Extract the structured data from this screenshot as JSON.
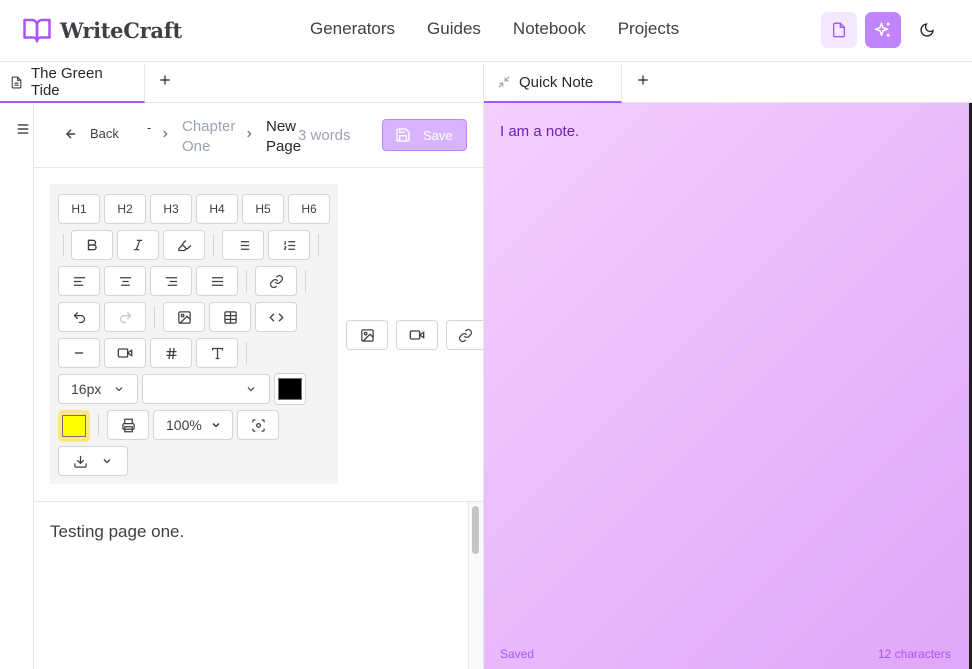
{
  "app": {
    "name": "WriteCraft",
    "nav": [
      "Generators",
      "Guides",
      "Notebook",
      "Projects"
    ]
  },
  "tabs_left": {
    "active": "The Green Tide"
  },
  "tabs_right": {
    "active": "Quick Note"
  },
  "page": {
    "back_label": "Back",
    "crumb_dash": "-",
    "crumb_chapter": "Chapter One",
    "crumb_page": "New Page",
    "word_count": "3 words",
    "save_label": "Save"
  },
  "toolbar": {
    "headings": [
      "H1",
      "H2",
      "H3",
      "H4",
      "H5",
      "H6"
    ],
    "font_size": "16px",
    "font_family": "",
    "zoom": "100%",
    "text_color": "#000000",
    "highlight_color": "#ffff00"
  },
  "editor": {
    "content": "Testing page one."
  },
  "note": {
    "content": "I am a note.",
    "status": "Saved",
    "char_count": "12 characters"
  },
  "colors": {
    "accent": "#a855f7",
    "note_bg": "#e9b8fb"
  }
}
